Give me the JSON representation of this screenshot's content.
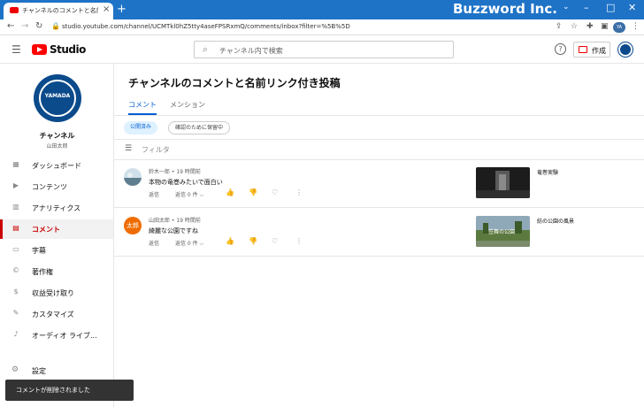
{
  "browser": {
    "tab_title": "チャンネルのコメントと名前リンク付き...",
    "new_tab": "+",
    "brand": "Buzzword Inc.",
    "url": "studio.youtube.com/channel/UCMTkl0hZ5tty4aseFPSRxmQ/comments/inbox?filter=%5B%5D",
    "minimize": "–",
    "maximize": "□",
    "close": "✕",
    "back": "←",
    "forward": "→",
    "reload": "C"
  },
  "studio": {
    "logo_text": "Studio",
    "search_placeholder": "チャンネル内で検索",
    "help": "?",
    "create_label": "作成"
  },
  "sidebar": {
    "avatar_text": "YAMADA",
    "channel_name": "チャンネル",
    "channel_owner": "山田太郎",
    "items": [
      {
        "label": "ダッシュボード",
        "icon": "▦"
      },
      {
        "label": "コンテンツ",
        "icon": "▶"
      },
      {
        "label": "アナリティクス",
        "icon": "▥"
      },
      {
        "label": "コメント",
        "icon": "▤"
      },
      {
        "label": "字幕",
        "icon": "▭"
      },
      {
        "label": "著作権",
        "icon": "©"
      },
      {
        "label": "収益受け取り",
        "icon": "$"
      },
      {
        "label": "カスタマイズ",
        "icon": "✎"
      },
      {
        "label": "オーディオ ライブ...",
        "icon": "♪"
      }
    ],
    "settings_label": "設定",
    "settings_icon": "⚙"
  },
  "main": {
    "title": "チャンネルのコメントと名前リンク付き投稿",
    "tabs": [
      {
        "label": "コメント"
      },
      {
        "label": "メンション"
      }
    ],
    "chips": [
      {
        "label": "公開済み"
      },
      {
        "label": "確認のために保留中"
      }
    ],
    "filter_label": "フィルタ",
    "comments": [
      {
        "author_time": "鈴木一郎 • 19 時間前",
        "text": "本物の竜巻みたいで面白い",
        "reply": "返信",
        "replies": "返信 0 件 ⌵",
        "video_title": "竜巻実験"
      },
      {
        "author_time": "山田太郎 • 19 時間前",
        "text": "綺麗な公園ですね",
        "reply": "返信",
        "replies": "返信 0 件 ⌵",
        "avatar_text": "太郎",
        "video_title": "紡の公園の風景",
        "thumb_caption": "笠舞の公園"
      }
    ]
  },
  "snackbar": {
    "text": "コメントが削除されました"
  },
  "colors": {
    "accent_red": "#cc0000",
    "link_blue": "#065fd4",
    "titlebar": "#1e73c7"
  }
}
